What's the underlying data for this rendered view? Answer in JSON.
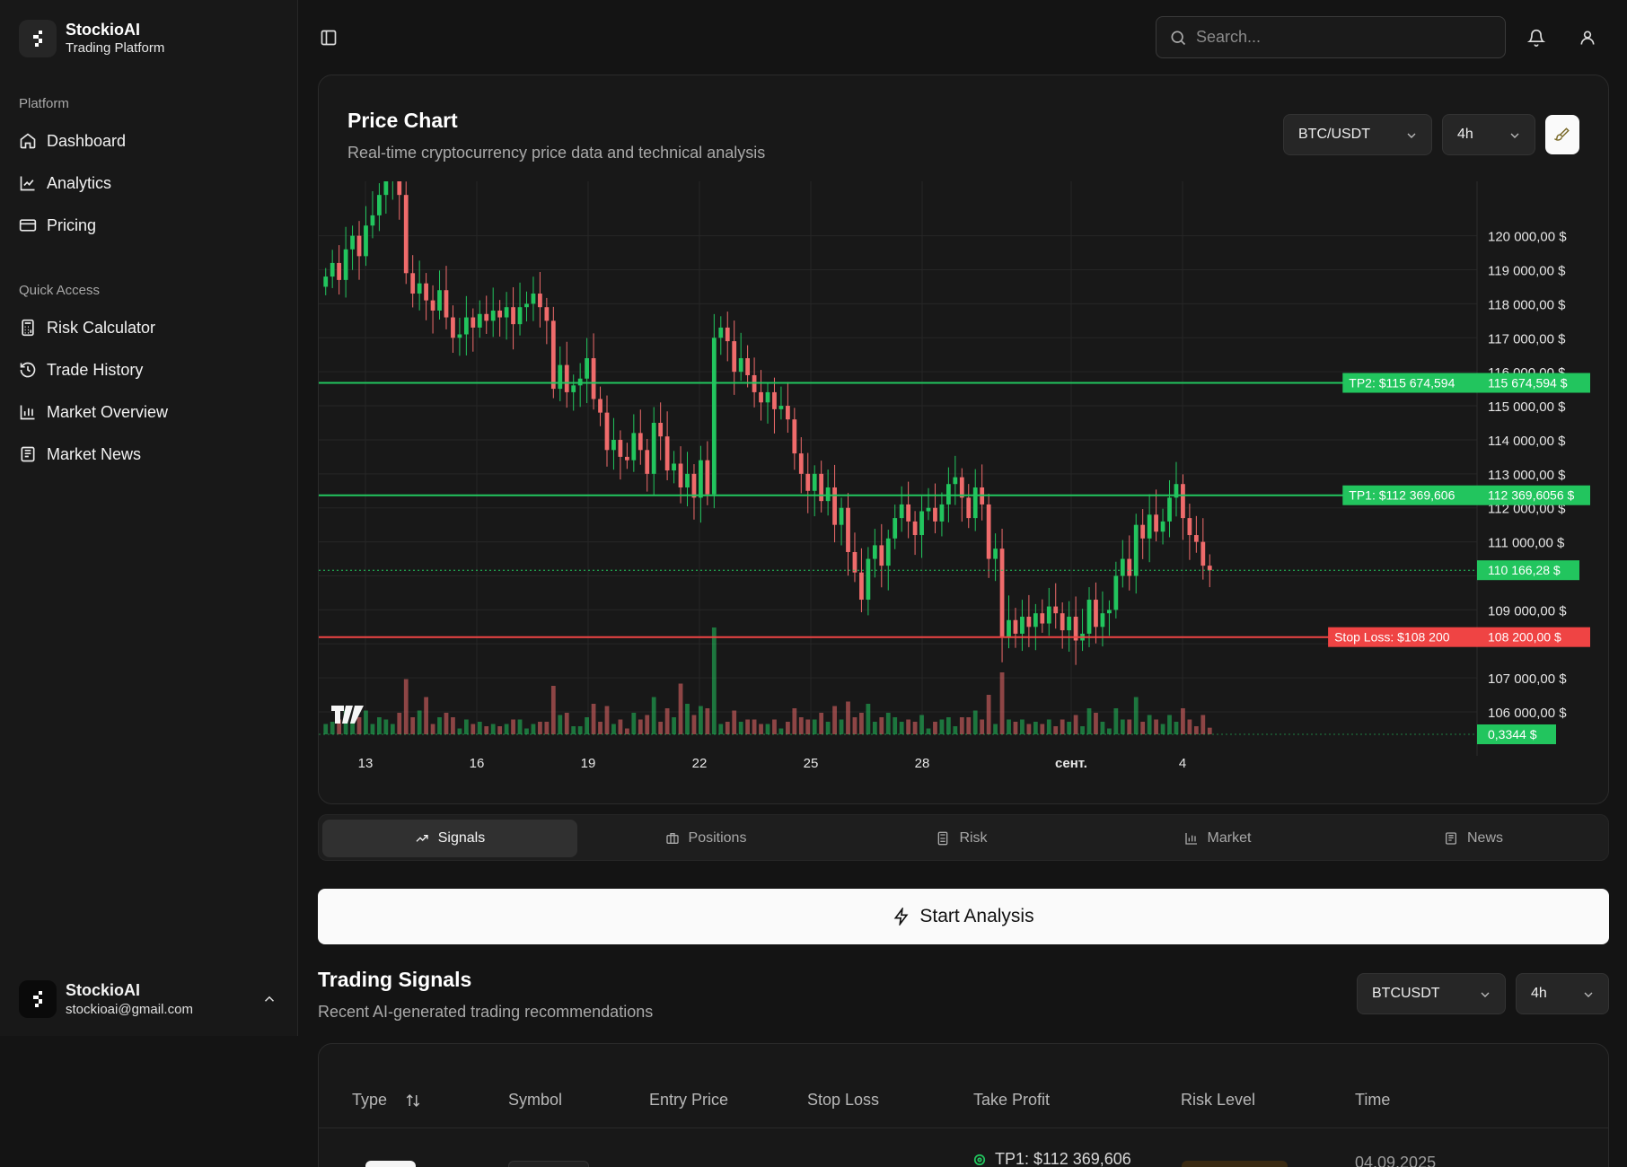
{
  "brand": {
    "name": "StockioAI",
    "tagline": "Trading Platform"
  },
  "sidebar": {
    "platform_label": "Platform",
    "platform_items": [
      {
        "label": "Dashboard",
        "icon": "home-icon"
      },
      {
        "label": "Analytics",
        "icon": "line-chart-icon"
      },
      {
        "label": "Pricing",
        "icon": "credit-card-icon"
      }
    ],
    "quick_label": "Quick Access",
    "quick_items": [
      {
        "label": "Risk Calculator",
        "icon": "calculator-icon"
      },
      {
        "label": "Trade History",
        "icon": "history-icon"
      },
      {
        "label": "Market Overview",
        "icon": "bar-chart-icon"
      },
      {
        "label": "Market News",
        "icon": "newspaper-icon"
      }
    ]
  },
  "user": {
    "name": "StockioAI",
    "email": "stockioai@gmail.com"
  },
  "header": {
    "search_placeholder": "Search..."
  },
  "price_chart": {
    "title": "Price Chart",
    "subtitle": "Real-time cryptocurrency price data and technical analysis",
    "pair": "BTC/USDT",
    "interval": "4h"
  },
  "tabs": [
    "Signals",
    "Positions",
    "Risk",
    "Market",
    "News"
  ],
  "start_button": "Start Analysis",
  "signals": {
    "title": "Trading Signals",
    "subtitle": "Recent AI-generated trading recommendations",
    "symbol": "BTCUSDT",
    "interval": "4h",
    "columns": [
      "Type",
      "Symbol",
      "Entry Price",
      "Stop Loss",
      "Take Profit",
      "Risk Level",
      "Time"
    ],
    "first_row": {
      "take_profit": "TP1: $112 369,606",
      "time": "04.09.2025"
    }
  },
  "colors": {
    "up": "#22c55e",
    "down": "#ef6b6b",
    "stop": "#ef4444",
    "tp": "#22c55e"
  },
  "chart_data": {
    "type": "candlestick",
    "y_ticks": [
      "120 000,00 $",
      "119 000,00 $",
      "118 000,00 $",
      "117 000,00 $",
      "116 000,00 $",
      "115 000,00 $",
      "114 000,00 $",
      "113 000,00 $",
      "112 000,00 $",
      "111 000,00 $",
      "109 000,00 $",
      "107 000,00 $",
      "106 000,00 $"
    ],
    "x_ticks": [
      "13",
      "16",
      "19",
      "22",
      "25",
      "28",
      "сент.",
      "4"
    ],
    "levels": [
      {
        "label": "TP2: $115 674,594",
        "price_tag": "115 674,594 $",
        "value": 115674.594,
        "kind": "tp"
      },
      {
        "label": "TP1: $112 369,606",
        "price_tag": "112 369,6056 $",
        "value": 112369.6056,
        "kind": "tp"
      },
      {
        "label": "Stop Loss: $108 200",
        "price_tag": "108 200,00 $",
        "value": 108200,
        "kind": "stop"
      }
    ],
    "last_price_tag": "110 166,28 $",
    "last_price": 110166.28,
    "volume_tag": "0,3344 $",
    "candles_close": [
      118800,
      119200,
      118700,
      119600,
      120000,
      119400,
      120300,
      120600,
      121200,
      121700,
      122000,
      121200,
      118900,
      118300,
      118600,
      118100,
      117800,
      118400,
      117600,
      117000,
      117100,
      117600,
      117300,
      117700,
      117500,
      117800,
      117600,
      117900,
      117400,
      117900,
      118000,
      118300,
      117900,
      117500,
      115500,
      116200,
      115400,
      115600,
      115800,
      116400,
      115200,
      114800,
      113700,
      114000,
      113500,
      113400,
      114200,
      113700,
      113000,
      114500,
      114100,
      113100,
      113300,
      112600,
      113000,
      112300,
      113400,
      112400,
      117000,
      117300,
      116900,
      116000,
      116400,
      115900,
      115400,
      115100,
      115400,
      114900,
      115000,
      114600,
      113600,
      113000,
      112500,
      113000,
      112200,
      112600,
      111500,
      112000,
      110700,
      110100,
      109300,
      110500,
      110900,
      110300,
      111100,
      111700,
      112100,
      111600,
      111200,
      111900,
      112000,
      111600,
      112100,
      112700,
      112900,
      112300,
      111700,
      112600,
      112100,
      110500,
      110800,
      108200,
      108700,
      108300,
      108800,
      108500,
      108900,
      108600,
      109100,
      108900,
      108400,
      108800,
      108100,
      108300,
      109300,
      108500,
      108900,
      109000,
      110000,
      110500,
      110000,
      111500,
      111100,
      111800,
      111300,
      111600,
      112300,
      112700,
      111700,
      111200,
      111000,
      110300,
      110166
    ],
    "price_range": [
      105500,
      121600
    ]
  }
}
